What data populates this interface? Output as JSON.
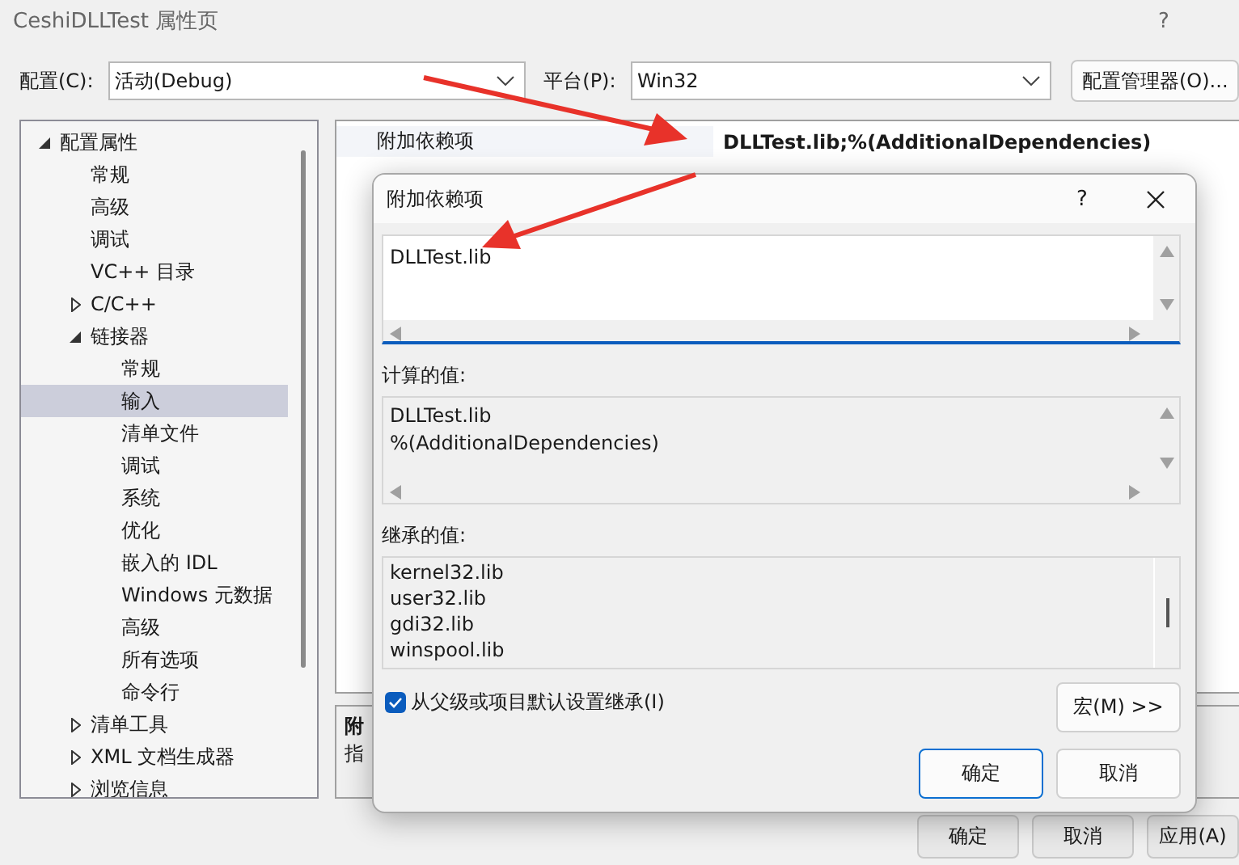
{
  "window": {
    "title": "CeshiDLLTest 属性页",
    "help": "?"
  },
  "toolbar": {
    "config_label": "配置(C):",
    "config_value": "活动(Debug)",
    "platform_label": "平台(P):",
    "platform_value": "Win32",
    "manager_button": "配置管理器(O)..."
  },
  "tree": [
    {
      "label": "配置属性",
      "expanded": true,
      "selected": false,
      "children": [
        {
          "label": "常规",
          "selected": false
        },
        {
          "label": "高级",
          "selected": false
        },
        {
          "label": "调试",
          "selected": false
        },
        {
          "label": "VC++ 目录",
          "selected": false
        },
        {
          "label": "C/C++",
          "expanded": false,
          "selected": false
        },
        {
          "label": "链接器",
          "expanded": true,
          "selected": false,
          "children": [
            {
              "label": "常规",
              "selected": false
            },
            {
              "label": "输入",
              "selected": true
            },
            {
              "label": "清单文件",
              "selected": false
            },
            {
              "label": "调试",
              "selected": false
            },
            {
              "label": "系统",
              "selected": false
            },
            {
              "label": "优化",
              "selected": false
            },
            {
              "label": "嵌入的 IDL",
              "selected": false
            },
            {
              "label": "Windows 元数据",
              "selected": false
            },
            {
              "label": "高级",
              "selected": false
            },
            {
              "label": "所有选项",
              "selected": false
            },
            {
              "label": "命令行",
              "selected": false
            }
          ]
        },
        {
          "label": "清单工具",
          "expanded": false,
          "selected": false
        },
        {
          "label": "XML 文档生成器",
          "expanded": false,
          "selected": false
        },
        {
          "label": "浏览信息",
          "expanded": false,
          "selected": false
        }
      ]
    }
  ],
  "properties": [
    {
      "name": "附加依赖项",
      "value": "DLLTest.lib;%(AdditionalDependencies)"
    }
  ],
  "description": {
    "title": "附",
    "text": "指"
  },
  "dialog": {
    "title": "附加依赖项",
    "help": "?",
    "edit_value": "DLLTest.lib",
    "computed_label": "计算的值:",
    "computed_lines": [
      "DLLTest.lib",
      "%(AdditionalDependencies)"
    ],
    "inherited_label": "继承的值:",
    "inherited_lines": [
      "kernel32.lib",
      "user32.lib",
      "gdi32.lib",
      "winspool.lib"
    ],
    "inherit_checkbox": {
      "label": "从父级或项目默认设置继承(I)",
      "checked": true
    },
    "macro_button": "宏(M) >>",
    "buttons": [
      "确定",
      "取消"
    ]
  },
  "buttons": [
    "确定",
    "取消",
    "应用(A)"
  ]
}
